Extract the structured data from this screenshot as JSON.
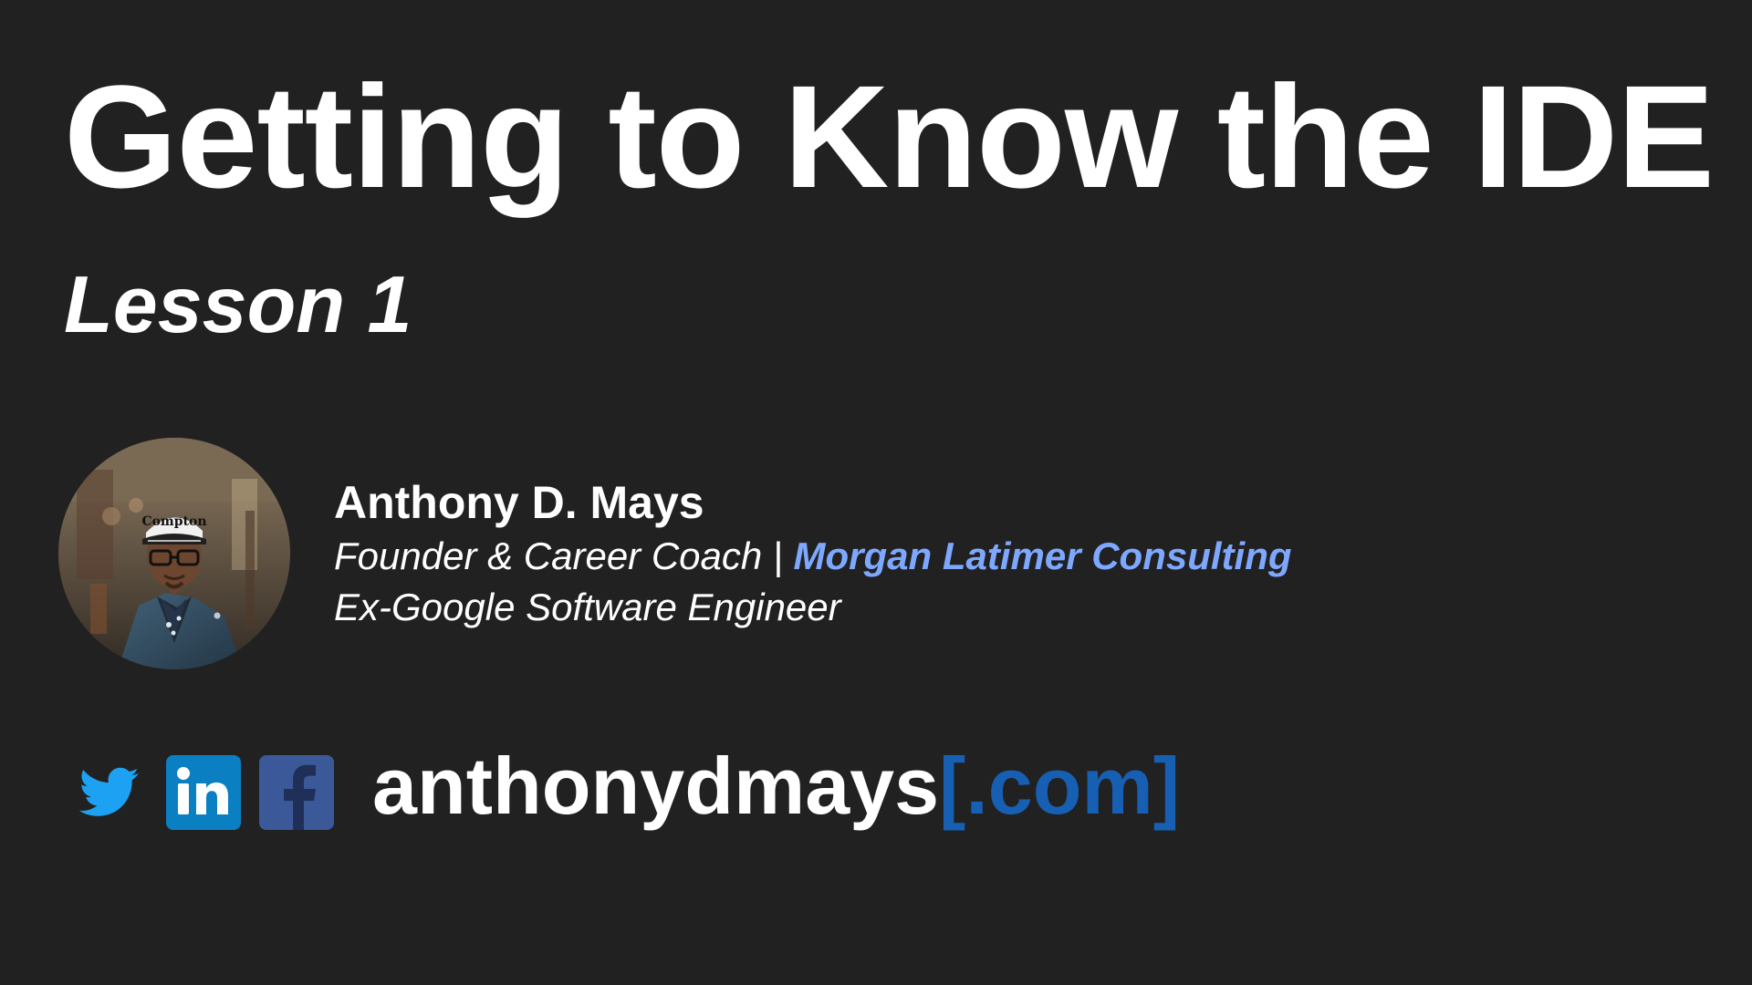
{
  "slide": {
    "title": "Getting to Know the IDE",
    "subtitle": "Lesson 1"
  },
  "presenter": {
    "name": "Anthony D. Mays",
    "role_prefix": "Founder & Career Coach",
    "separator": " | ",
    "company": "Morgan Latimer Consulting",
    "career": "Ex-Google Software Engineer",
    "avatar_icon": "presenter-photo"
  },
  "footer": {
    "website_main": "anthonydmays",
    "website_tail": "[.com]",
    "icons": {
      "twitter": "twitter-icon",
      "linkedin": "linkedin-icon",
      "facebook": "facebook-icon"
    }
  },
  "colors": {
    "background": "#212121",
    "text": "#ffffff",
    "company": "#7ea8ff",
    "website_tail": "#165fb3",
    "twitter": "#1da1f2",
    "linkedin": "#0a7fc2",
    "facebook": "#3b5998"
  }
}
